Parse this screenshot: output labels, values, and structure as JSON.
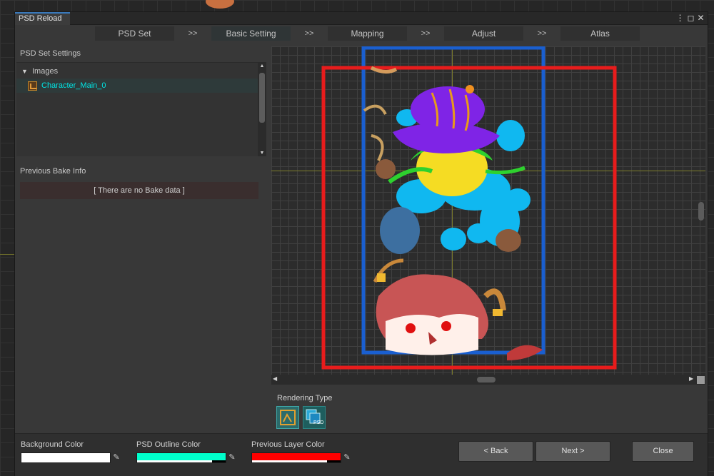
{
  "window": {
    "title": "PSD Reload",
    "menu_icon": "⋮",
    "maximize_icon": "◻",
    "close_icon": "✕"
  },
  "steps": [
    {
      "label": "PSD Set",
      "active": false
    },
    {
      "label": "Basic Setting",
      "active": true
    },
    {
      "label": "Mapping",
      "active": false
    },
    {
      "label": "Adjust",
      "active": false
    },
    {
      "label": "Atlas",
      "active": false
    }
  ],
  "step_separator": ">>",
  "left_panel": {
    "psd_set_settings": "PSD Set Settings",
    "tree": {
      "folder_label": "Images",
      "items": [
        {
          "label": "Character_Main_0",
          "color": "#00e5e5"
        }
      ]
    },
    "previous_bake_title": "Previous Bake Info",
    "no_bake_text": "[ There are no Bake data ]"
  },
  "rendering": {
    "label": "Rendering Type",
    "buttons": [
      {
        "name": "outline-mode-icon",
        "selected": true
      },
      {
        "name": "psd-image-mode-icon",
        "selected": false,
        "badge": "PSD"
      }
    ]
  },
  "footer": {
    "background_color": {
      "label": "Background Color",
      "color": "#ffffff",
      "alpha": 1.0
    },
    "psd_outline_color": {
      "label": "PSD Outline Color",
      "color": "#00ffcc",
      "alpha": 0.85
    },
    "previous_layer_color": {
      "label": "Previous Layer Color",
      "color": "#ff0000",
      "alpha": 0.85
    },
    "back_label": "< Back",
    "next_label": "Next >",
    "close_label": "Close"
  },
  "colors": {
    "psd_outline": "#1a5fd0",
    "previous_layer": "#e81c1c",
    "selection_accent": "#00e5e5"
  }
}
